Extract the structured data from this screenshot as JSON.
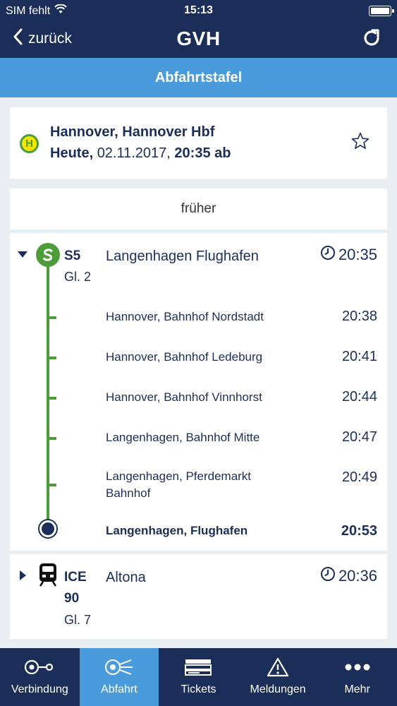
{
  "status_bar": {
    "carrier": "SIM fehlt",
    "time": "15:13"
  },
  "nav": {
    "back_label": "zurück",
    "title": "GVH"
  },
  "section_title": "Abfahrtstafel",
  "station": {
    "stop_icon_letter": "H",
    "name": "Hannover, Hannover Hbf",
    "day": "Heute,",
    "date": "02.11.2017,",
    "time": "20:35 ab"
  },
  "earlier_label": "früher",
  "departures": [
    {
      "line": "S5",
      "track": "Gl. 2",
      "destination": "Langenhagen Flughafen",
      "time": "20:35",
      "line_color": "#4e9b3a",
      "stops": [
        {
          "name": "Hannover, Bahnhof Nordstadt",
          "time": "20:38"
        },
        {
          "name": "Hannover, Bahnhof Ledeburg",
          "time": "20:41"
        },
        {
          "name": "Hannover, Bahnhof Vinnhorst",
          "time": "20:44"
        },
        {
          "name": "Langenhagen, Bahnhof Mitte",
          "time": "20:47"
        },
        {
          "name": "Langenhagen, Pferdemarkt Bahnhof",
          "time": "20:49"
        },
        {
          "name": "Langenhagen, Flughafen",
          "time": "20:53"
        }
      ]
    },
    {
      "line": "ICE",
      "line_number": "90",
      "track": "Gl. 7",
      "destination": "Altona",
      "time": "20:36"
    }
  ],
  "tabs": [
    {
      "label": "Verbindung",
      "icon": "connection-icon",
      "active": false
    },
    {
      "label": "Abfahrt",
      "icon": "departure-icon",
      "active": true
    },
    {
      "label": "Tickets",
      "icon": "tickets-icon",
      "active": false
    },
    {
      "label": "Meldungen",
      "icon": "warning-icon",
      "active": false
    },
    {
      "label": "Mehr",
      "icon": "more-icon",
      "active": false
    }
  ],
  "colors": {
    "navy": "#1b2e5a",
    "accent": "#4a9bdb",
    "sbahn_green": "#4e9b3a",
    "stop_yellow": "#f2e600"
  }
}
